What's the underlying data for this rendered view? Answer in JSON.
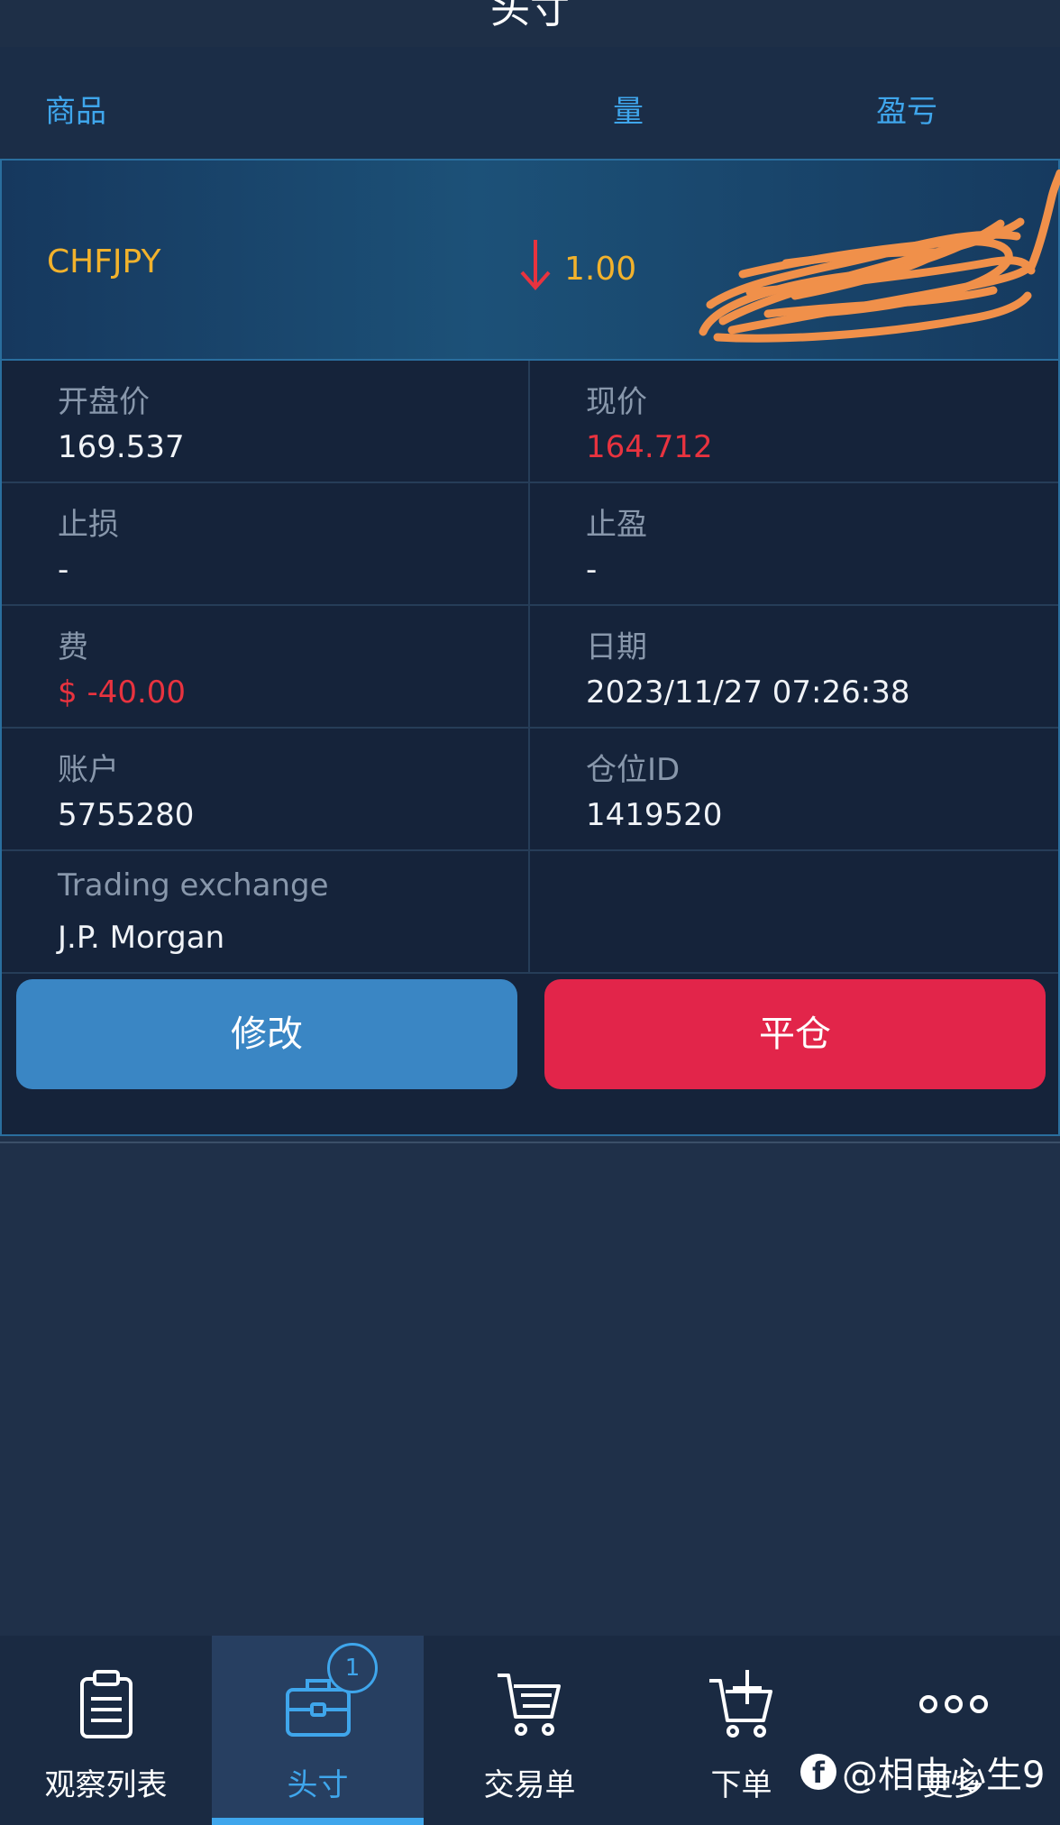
{
  "header": {
    "title": "头寸"
  },
  "columns": {
    "product": "商品",
    "volume": "量",
    "pnl": "盈亏"
  },
  "position": {
    "symbol": "CHFJPY",
    "direction": "down",
    "volume": "1.00",
    "fields": {
      "open_price_label": "开盘价",
      "open_price": "169.537",
      "current_price_label": "现价",
      "current_price": "164.712",
      "stop_loss_label": "止损",
      "stop_loss": "-",
      "take_profit_label": "止盈",
      "take_profit": "-",
      "fee_label": "费",
      "fee": "$ -40.00",
      "date_label": "日期",
      "date": "2023/11/27 07:26:38",
      "account_label": "账户",
      "account": "5755280",
      "position_id_label": "仓位ID",
      "position_id": "1419520",
      "exchange_label": "Trading exchange",
      "exchange": "J.P. Morgan"
    },
    "modify_label": "修改",
    "close_label": "平仓"
  },
  "nav": {
    "items": [
      {
        "label": "观察列表",
        "icon": "clipboard-icon"
      },
      {
        "label": "头寸",
        "icon": "briefcase-icon",
        "badge": "1",
        "active": true
      },
      {
        "label": "交易单",
        "icon": "cart-list-icon"
      },
      {
        "label": "下单",
        "icon": "cart-plus-icon"
      },
      {
        "label": "更多",
        "icon": "more-dots-icon"
      }
    ]
  },
  "watermark": {
    "logo": "f",
    "text": "@相由心生9"
  },
  "colors": {
    "accent": "#3fa6ec",
    "symbol": "#f2b22c",
    "loss": "#e8333f",
    "modify_button": "#3a86c4",
    "close_button": "#e2254a",
    "redaction": "#f0904a"
  }
}
